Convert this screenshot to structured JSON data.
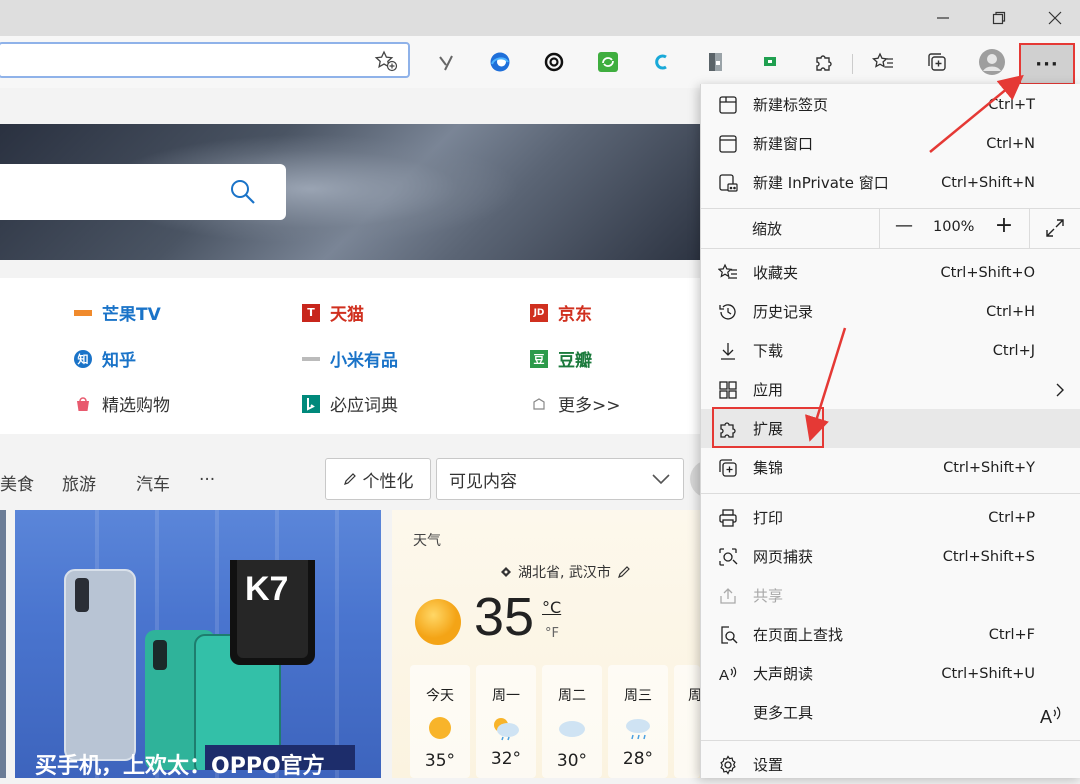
{
  "window": {
    "minimize_icon": "minimize-icon",
    "restore_icon": "restore-icon",
    "close_icon": "close-icon"
  },
  "toolbar": {
    "favorite_icon": "add-favorite-icon",
    "extensions": [
      "y-extension-icon",
      "edge-logo-icon",
      "copilot-icon",
      "refresh-extension-icon",
      "c-extension-icon",
      "document-extension-icon",
      "green-extension-icon",
      "puzzle-icon"
    ],
    "more_label": "···"
  },
  "search": {
    "icon": "search-icon"
  },
  "quicklinks": [
    {
      "label": "芒果TV",
      "style": "blue"
    },
    {
      "label": "天猫",
      "style": "red"
    },
    {
      "label": "京东",
      "style": "red"
    },
    {
      "label": "知乎",
      "style": "blue"
    },
    {
      "label": "小米有品",
      "style": "blue"
    },
    {
      "label": "豆瓣",
      "style": "green"
    },
    {
      "label": "精选购物",
      "style": "plain"
    },
    {
      "label": "必应词典",
      "style": "plain"
    },
    {
      "label": "更多>>",
      "style": "plain"
    }
  ],
  "categories": {
    "c1": "美食",
    "c2": "旅游",
    "c3": "汽车",
    "more": "···"
  },
  "feed": {
    "personalize": "个性化",
    "visible_content": "可见内容",
    "card_title": "买手机，上欢太：OPPO官方"
  },
  "weather": {
    "title": "天气",
    "location": "湖北省, 武汉市",
    "temp": "35",
    "unit_c": "°C",
    "unit_f": "°F",
    "days": [
      {
        "name": "今天",
        "temp": "35°"
      },
      {
        "name": "周一",
        "temp": "32°"
      },
      {
        "name": "周二",
        "temp": "30°"
      },
      {
        "name": "周三",
        "temp": "28°"
      },
      {
        "name": "周",
        "temp": ""
      }
    ]
  },
  "menu": {
    "new_tab": {
      "label": "新建标签页",
      "shortcut": "Ctrl+T"
    },
    "new_window": {
      "label": "新建窗口",
      "shortcut": "Ctrl+N"
    },
    "new_inprivate": {
      "label": "新建 InPrivate 窗口",
      "shortcut": "Ctrl+Shift+N"
    },
    "zoom": {
      "label": "缩放",
      "value": "100%",
      "minus": "—",
      "plus": "+"
    },
    "favorites": {
      "label": "收藏夹",
      "shortcut": "Ctrl+Shift+O"
    },
    "history": {
      "label": "历史记录",
      "shortcut": "Ctrl+H"
    },
    "downloads": {
      "label": "下载",
      "shortcut": "Ctrl+J"
    },
    "apps": {
      "label": "应用",
      "shortcut": ""
    },
    "extensions": {
      "label": "扩展",
      "shortcut": ""
    },
    "collections": {
      "label": "集锦",
      "shortcut": "Ctrl+Shift+Y"
    },
    "print": {
      "label": "打印",
      "shortcut": "Ctrl+P"
    },
    "web_capture": {
      "label": "网页捕获",
      "shortcut": "Ctrl+Shift+S"
    },
    "share": {
      "label": "共享",
      "shortcut": ""
    },
    "find": {
      "label": "在页面上查找",
      "shortcut": "Ctrl+F"
    },
    "read_aloud": {
      "label": "大声朗读",
      "shortcut": "Ctrl+Shift+U"
    },
    "more_tools": {
      "label": "更多工具",
      "shortcut": ""
    },
    "settings": {
      "label": "设置",
      "shortcut": ""
    }
  },
  "colors": {
    "annotation_red": "#e53935",
    "highlight": "#e8e8e8",
    "link_blue": "#1a73c8",
    "link_red": "#d0301f"
  }
}
